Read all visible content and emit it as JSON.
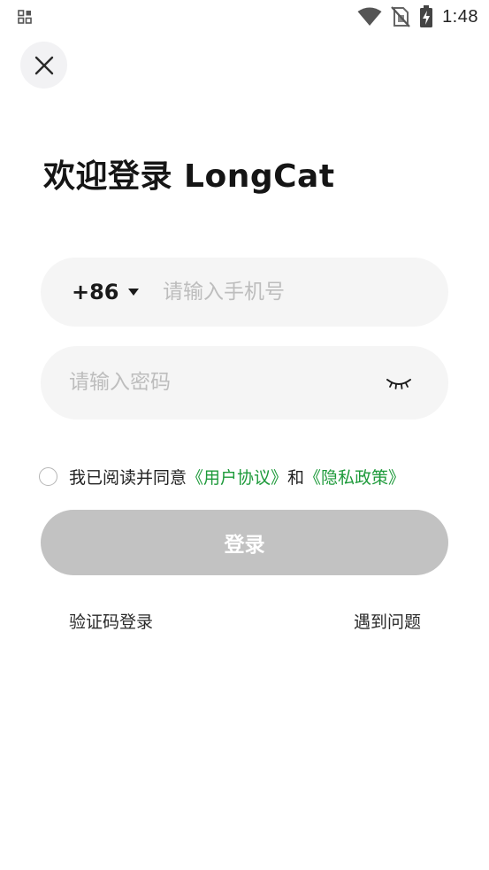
{
  "status_bar": {
    "time": "1:48",
    "left_icon": "notification-grid-icon",
    "icons": [
      "wifi-icon",
      "no-sim-icon",
      "battery-charging-icon"
    ]
  },
  "header": {
    "close_icon": "close-icon"
  },
  "title": "欢迎登录 LongCat",
  "phone": {
    "country_code": "+86",
    "dropdown_icon": "caret-down-icon",
    "placeholder": "请输入手机号",
    "value": ""
  },
  "password": {
    "placeholder": "请输入密码",
    "value": "",
    "visibility_icon": "eye-closed-icon"
  },
  "agreement": {
    "checked": false,
    "prefix": "我已阅读并同意",
    "user_agreement": "《用户协议》",
    "conjunction": "和",
    "privacy_policy": "《隐私政策》",
    "link_color": "#1d9a3a"
  },
  "login_button": {
    "label": "登录",
    "disabled": true,
    "color": "#c2c2c2"
  },
  "footer": {
    "sms_login": "验证码登录",
    "help": "遇到问题"
  }
}
